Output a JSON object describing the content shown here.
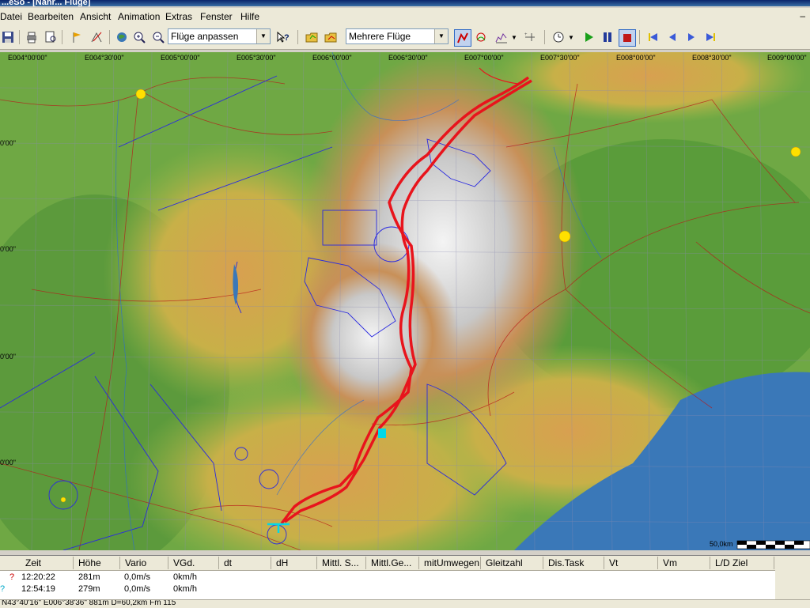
{
  "window": {
    "title": "...eSo - [Nahr... Flüge]"
  },
  "menu": [
    "Datei",
    "Bearbeiten",
    "Ansicht",
    "Animation",
    "Extras",
    "Fenster",
    "Hilfe"
  ],
  "toolbar": {
    "zoom_combo": "Flüge anpassen",
    "flights_combo": "Mehrere Flüge"
  },
  "map": {
    "longitude_labels": [
      "E004°00'00\"",
      "E004°30'00\"",
      "E005°00'00\"",
      "E005°30'00\"",
      "E006°00'00\"",
      "E006°30'00\"",
      "E007°00'00\"",
      "E007°30'00\"",
      "E008°00'00\"",
      "E008°30'00\"",
      "E009°00'00\""
    ],
    "latitude_labels": [
      "0'00\"",
      "0'00\"",
      "0'00\"",
      "0'00\""
    ],
    "scale_label": "50,0km"
  },
  "table": {
    "columns": [
      "Zeit",
      "Höhe",
      "Vario",
      "VGd.",
      "dt",
      "dH",
      "Mittl. S...",
      "Mittl.Ge...",
      "mitUmwegen",
      "Gleitzahl",
      "Dis.Task",
      "Vt",
      "Vm",
      "L/D Ziel"
    ],
    "rows": [
      {
        "marker": "?",
        "zeit": "12:20:22",
        "hoehe": "281m",
        "vario": "0,0m/s",
        "vgd": "0km/h"
      },
      {
        "marker": "?",
        "zeit": "12:54:19",
        "hoehe": "279m",
        "vario": "0,0m/s",
        "vgd": "0km/h"
      }
    ]
  },
  "status": {
    "text": "N43°40'16\" E006°38'36\" 881m  D=60,2km Fm 115"
  },
  "colors": {
    "track": "#e8141c",
    "airspace": "#2a2ae0",
    "sea": "#3a78b8"
  }
}
